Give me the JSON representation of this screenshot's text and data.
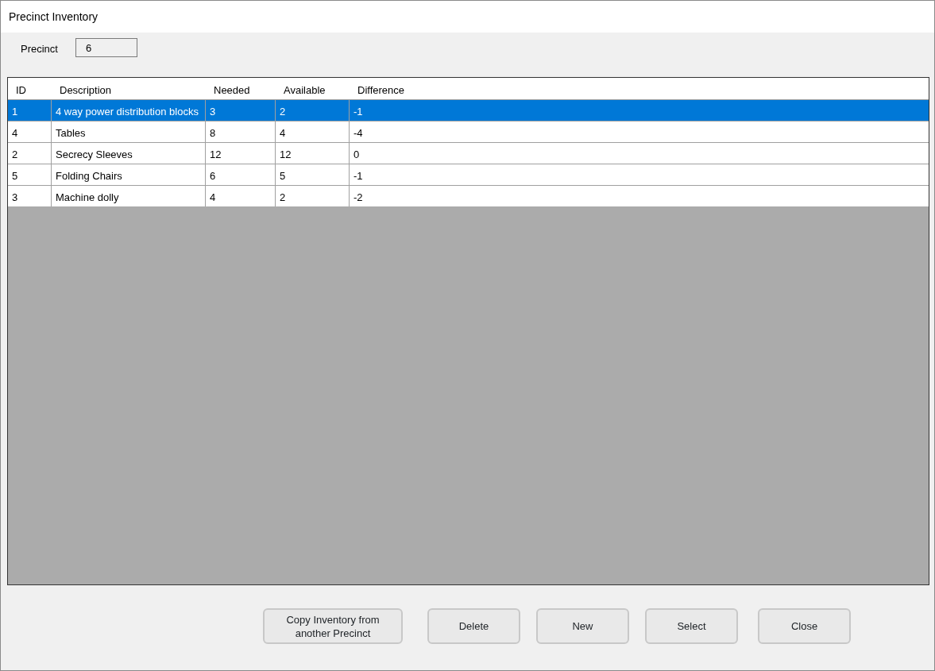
{
  "window": {
    "title": "Precinct Inventory"
  },
  "precinct": {
    "label": "Precinct",
    "value": "6"
  },
  "table": {
    "columns": [
      "ID",
      "Description",
      "Needed",
      "Available",
      "Difference"
    ],
    "rows": [
      {
        "cells": [
          "1",
          "4 way power distribution blocks",
          "3",
          "2",
          "-1"
        ],
        "selected": true
      },
      {
        "cells": [
          "4",
          "Tables",
          "8",
          "4",
          "-4"
        ],
        "selected": false
      },
      {
        "cells": [
          "2",
          "Secrecy Sleeves",
          "12",
          "12",
          "0"
        ],
        "selected": false
      },
      {
        "cells": [
          "5",
          "Folding Chairs",
          "6",
          "5",
          "-1"
        ],
        "selected": false
      },
      {
        "cells": [
          "3",
          "Machine dolly",
          "4",
          "2",
          "-2"
        ],
        "selected": false
      }
    ]
  },
  "buttons": [
    "Copy Inventory from another Precinct",
    "Delete",
    "New",
    "Select",
    "Close"
  ]
}
